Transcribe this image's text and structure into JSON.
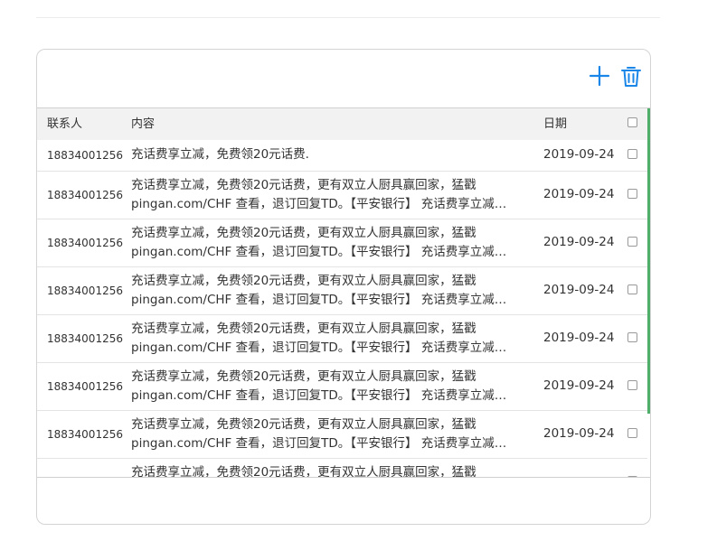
{
  "toolbar": {
    "add_icon": "plus-icon",
    "delete_icon": "trash-icon",
    "accent_color": "#1a86e8"
  },
  "table": {
    "headers": {
      "contact": "联系人",
      "content": "内容",
      "date": "日期"
    },
    "rows": [
      {
        "contact": "18834001256",
        "content_line1": "充话费享立减，免费领20元话费.",
        "content_line2": "",
        "date": "2019-09-24"
      },
      {
        "contact": "18834001256",
        "content_line1": "充话费享立减，免费领20元话费，更有双立人厨具赢回家，猛戳",
        "content_line2": "pingan.com/CHF 查看，退订回复TD。【平安银行】 充话费享立减…",
        "date": "2019-09-24"
      },
      {
        "contact": "18834001256",
        "content_line1": "充话费享立减，免费领20元话费，更有双立人厨具赢回家，猛戳",
        "content_line2": "pingan.com/CHF 查看，退订回复TD。【平安银行】 充话费享立减…",
        "date": "2019-09-24"
      },
      {
        "contact": "18834001256",
        "content_line1": "充话费享立减，免费领20元话费，更有双立人厨具赢回家，猛戳",
        "content_line2": "pingan.com/CHF 查看，退订回复TD。【平安银行】 充话费享立减…",
        "date": "2019-09-24"
      },
      {
        "contact": "18834001256",
        "content_line1": "充话费享立减，免费领20元话费，更有双立人厨具赢回家，猛戳",
        "content_line2": "pingan.com/CHF 查看，退订回复TD。【平安银行】 充话费享立减…",
        "date": "2019-09-24"
      },
      {
        "contact": "18834001256",
        "content_line1": "充话费享立减，免费领20元话费，更有双立人厨具赢回家，猛戳",
        "content_line2": "pingan.com/CHF 查看，退订回复TD。【平安银行】 充话费享立减…",
        "date": "2019-09-24"
      },
      {
        "contact": "18834001256",
        "content_line1": "充话费享立减，免费领20元话费，更有双立人厨具赢回家，猛戳",
        "content_line2": "pingan.com/CHF 查看，退订回复TD。【平安银行】 充话费享立减…",
        "date": "2019-09-24"
      },
      {
        "contact": "",
        "content_line1": "充话费享立减，免费领20元话费，更有双立人厨具赢回家，猛戳",
        "content_line2": "",
        "date": ""
      }
    ]
  }
}
